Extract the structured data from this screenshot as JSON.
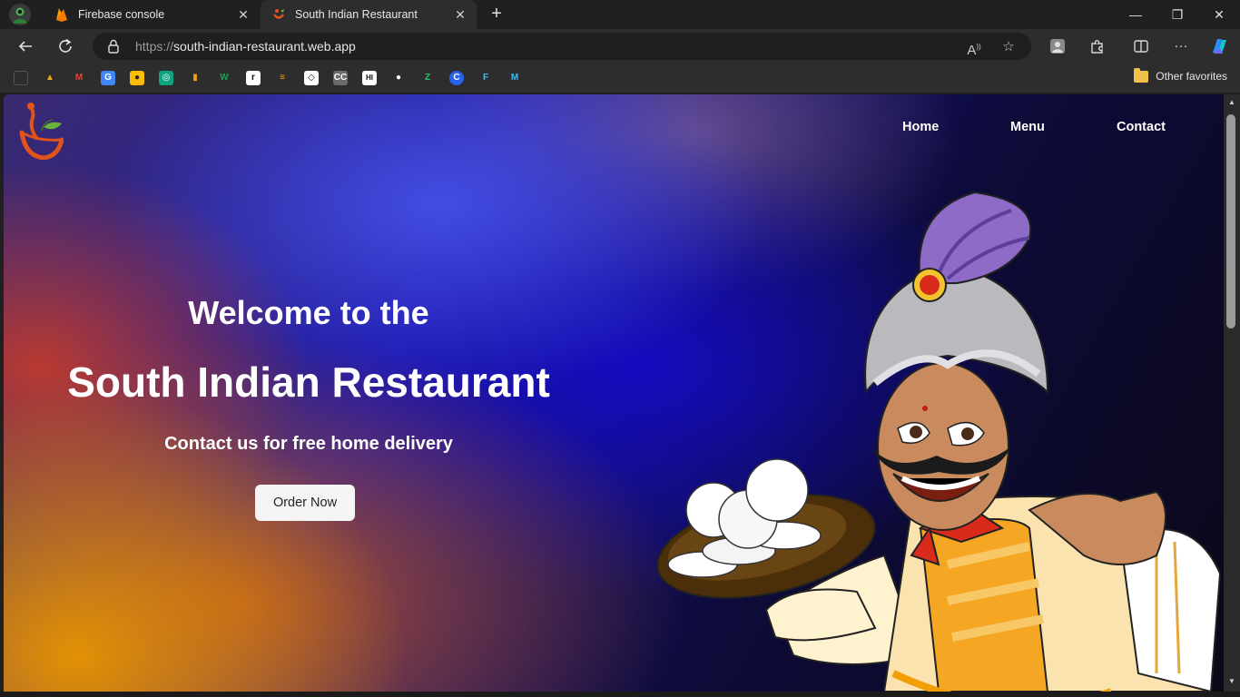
{
  "browser": {
    "tabs": [
      {
        "title": "Firebase console",
        "active": false
      },
      {
        "title": "South Indian Restaurant",
        "active": true
      }
    ],
    "url_scheme": "https://",
    "url_host": "south-indian-restaurant.web.app",
    "other_favorites_label": "Other favorites",
    "bookmark_icons": [
      "folder-icon",
      "firebase-icon",
      "gmail-icon",
      "translate-icon",
      "keep-icon",
      "chatgpt-icon",
      "bookmark-icon",
      "w-icon",
      "r-icon",
      "kaggle-icon",
      "codepen-icon",
      "cc-icon",
      "hashnode-icon",
      "github-icon",
      "z-icon",
      "c-icon",
      "fast-icon",
      "m-icon"
    ]
  },
  "site": {
    "nav": {
      "home": "Home",
      "menu": "Menu",
      "contact": "Contact"
    },
    "hero": {
      "line1": "Welcome to the",
      "line2": "South Indian Restaurant",
      "line3": "Contact us for free home delivery",
      "cta": "Order Now"
    }
  }
}
